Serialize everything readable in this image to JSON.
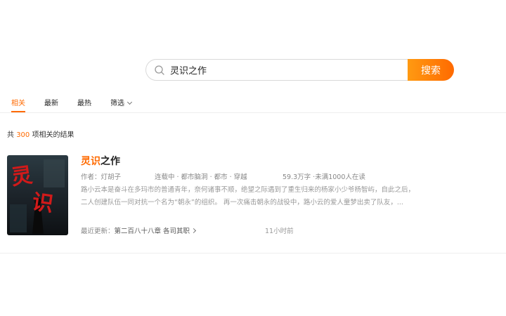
{
  "search": {
    "query": "灵识之作",
    "button_label": "搜索"
  },
  "tabs": [
    {
      "label": "相关",
      "active": true
    },
    {
      "label": "最新"
    },
    {
      "label": "最热"
    },
    {
      "label": "筛选"
    }
  ],
  "results": {
    "prefix": "共",
    "count": "300",
    "suffix": "项相关的结果"
  },
  "book": {
    "title_highlight": "灵识",
    "title_rest": "之作",
    "author": "作者：灯胡子",
    "status_tags": "连载中 · 都市脑洞 · 都市 · 穿越",
    "stats": "59.3万字 ·未满1000人在读",
    "desc_line1": "路小云本是奋斗在多玛市的普通青年，奈何诸事不顺，绝望之际遇到了重生归来的杨家小少爷杨智屿，自此之后，",
    "desc_line2": "二人创建队伍一同对抗一个名为“朝永”的组织。 再一次痛击朝永的战役中，路小云的爱人童梦出卖了队友，...",
    "latest_prefix": "最近更新：",
    "latest_chapter": "第二百八十八章 各司其职",
    "update_time": "11小时前",
    "cover_text": "灵识"
  },
  "colors": {
    "accent": "#ff6a00",
    "accent_light": "#ff9a12"
  }
}
